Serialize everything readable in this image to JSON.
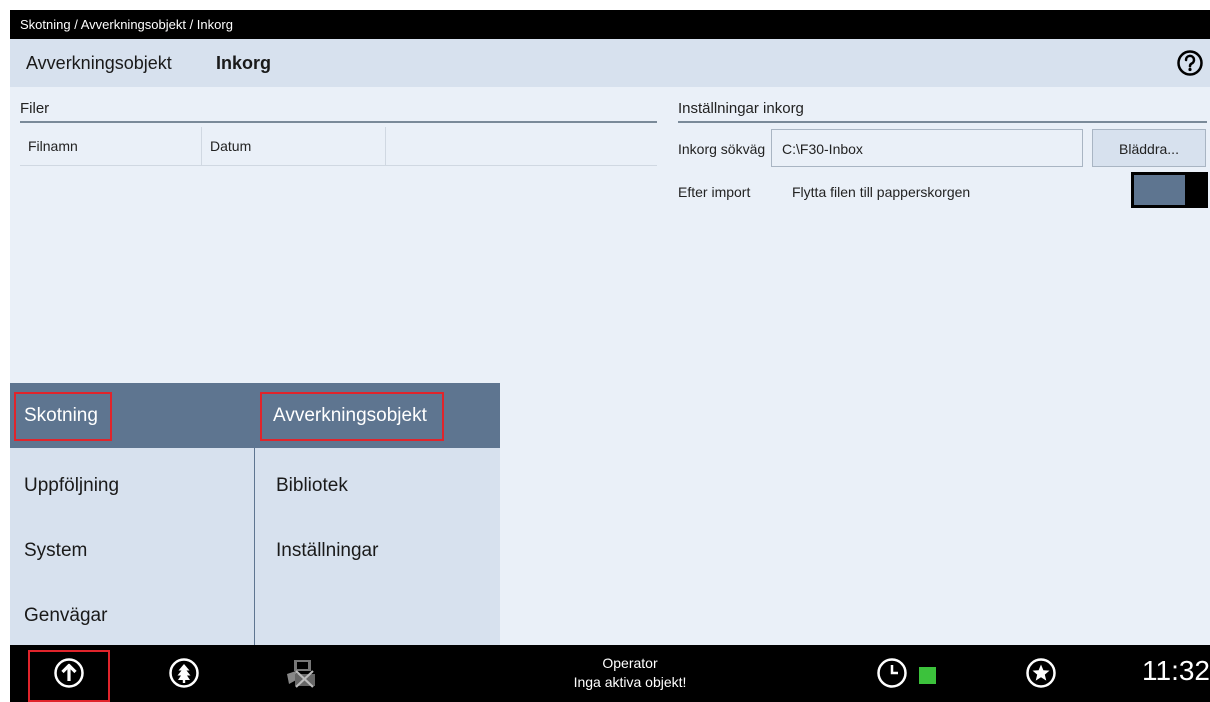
{
  "breadcrumb": "Skotning / Avverkningsobjekt / Inkorg",
  "topnav": {
    "items": [
      {
        "label": "Avverkningsobjekt"
      },
      {
        "label": "Inkorg"
      }
    ]
  },
  "files": {
    "title": "Filer",
    "columns": [
      "Filnamn",
      "Datum",
      ""
    ]
  },
  "settings": {
    "title": "Inställningar inkorg",
    "inbox_path_label": "Inkorg sökväg",
    "inbox_path_value": "C:\\F30-Inbox",
    "browse_label": "Bläddra...",
    "after_import_label": "Efter import",
    "after_import_value": "Flytta filen till papperskorgen"
  },
  "menu": {
    "col1": [
      {
        "label": "Skotning"
      },
      {
        "label": "Uppföljning"
      },
      {
        "label": "System"
      },
      {
        "label": "Genvägar"
      }
    ],
    "col2": [
      {
        "label": "Avverkningsobjekt"
      },
      {
        "label": "Bibliotek"
      },
      {
        "label": "Inställningar"
      }
    ]
  },
  "bottombar": {
    "operator": "Operator",
    "status": "Inga aktiva objekt!",
    "time": "11:32"
  },
  "icons": [
    "help-icon",
    "arrow-up-circle-icon",
    "tree-circle-icon",
    "machine-disconnected-icon",
    "clock-icon",
    "star-circle-icon"
  ],
  "colors": {
    "accent": "#5e7590",
    "highlight": "#e0242b",
    "status_ok": "#3cc23c"
  }
}
